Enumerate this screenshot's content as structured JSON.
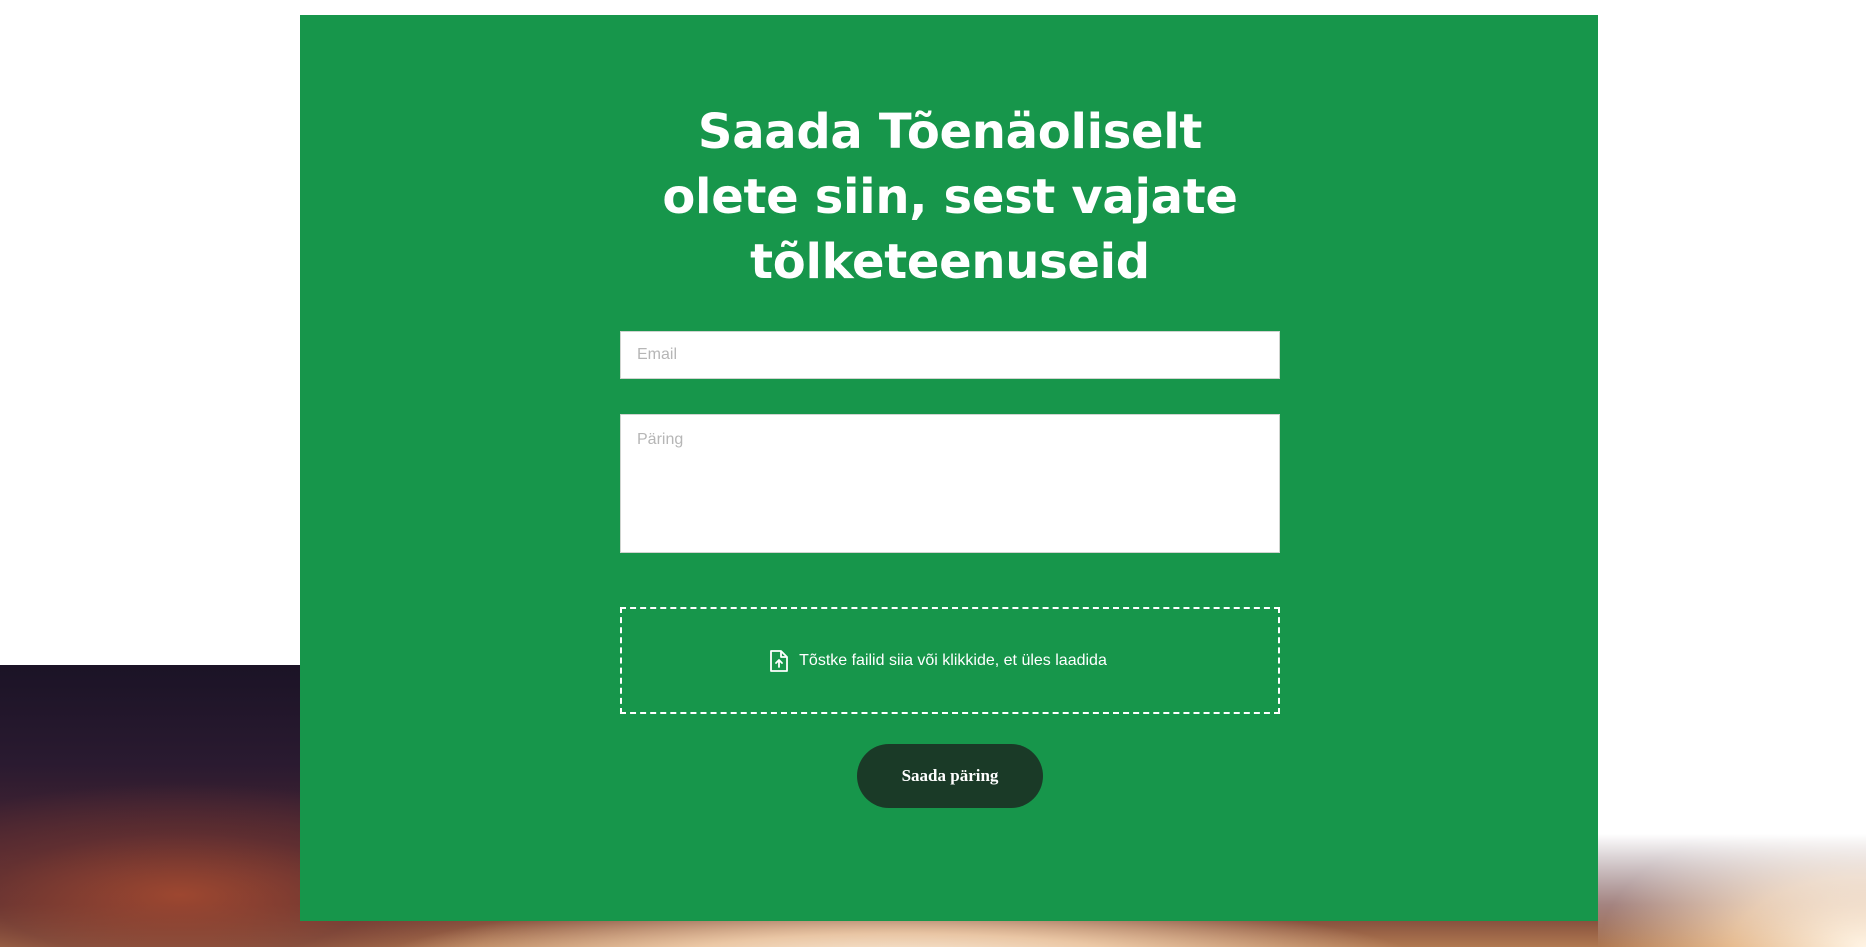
{
  "form": {
    "title": "Saada Tõenäoliselt olete siin, sest vajate tõlketeenuseid",
    "email_placeholder": "Email",
    "query_placeholder": "Päring",
    "dropzone_label": "Tõstke failid siia või klikkide, et üles laadida",
    "dropzone_icon": "file-upload-icon",
    "submit_label": "Saada päring"
  },
  "colors": {
    "panel_background": "#17964b",
    "button_background": "#1a3a27",
    "text_on_panel": "#ffffff"
  }
}
